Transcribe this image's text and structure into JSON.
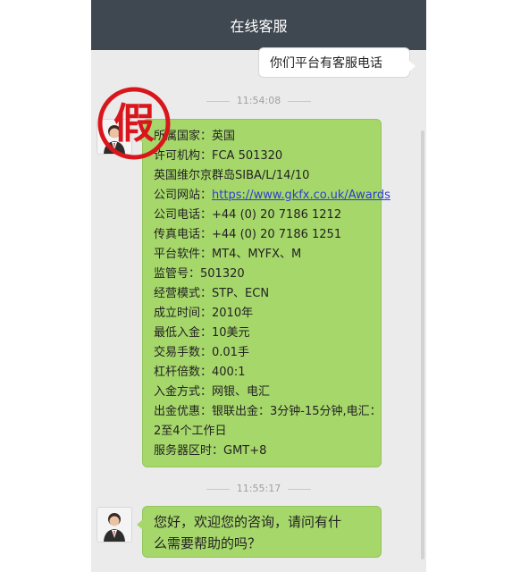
{
  "header": {
    "title": "在线客服"
  },
  "messages": {
    "user_question": "你们平台有客服电话",
    "time1": "11:54:08",
    "info_lines": [
      "所属国家：英国",
      "许可机构：FCA 501320",
      "英国维尔京群岛SIBA/L/14/10",
      "公司网站：",
      "公司电话：+44 (0) 20 7186 1212",
      "传真电话：+44 (0) 20 7186 1251",
      "平台软件：MT4、MYFX、M",
      "监管号：501320",
      "经营模式：STP、ECN",
      "成立时间：2010年",
      "最低入金：10美元",
      "交易手数：0.01手",
      "杠杆倍数：400:1",
      "入金方式：网银、电汇",
      "出金优惠：银联出金：3分钟-15分钟,电汇：",
      "2至4个工作日",
      "服务器区时：GMT+8"
    ],
    "website_url": "https://www.gkfx.co.uk/Awards",
    "time2": "11:55:17",
    "greeting_line1": "您好，欢迎您的咨询，请问有什",
    "greeting_line2": "么需要帮助的吗？"
  },
  "stamp": {
    "text": "假",
    "color": "#d9161c"
  },
  "colors": {
    "topbar": "#3f4750",
    "chat_bg": "#ebebeb",
    "bubble_green": "#a6d76b",
    "link": "#2a3ed0"
  }
}
